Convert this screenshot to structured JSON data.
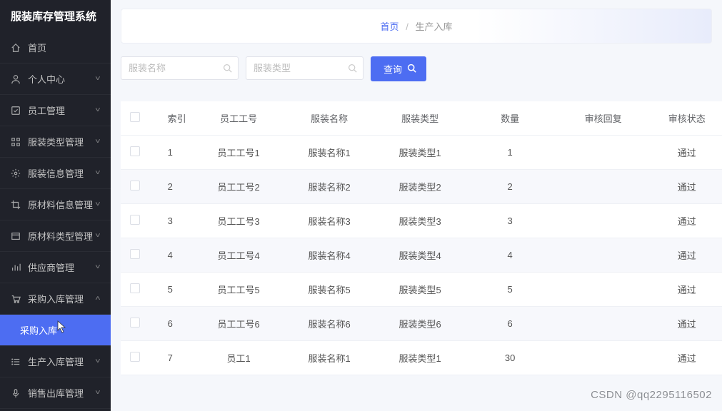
{
  "appTitle": "服装库存管理系统",
  "sidebar": {
    "items": [
      {
        "label": "首页",
        "icon": "home"
      },
      {
        "label": "个人中心",
        "icon": "user",
        "expandable": true,
        "state": "down"
      },
      {
        "label": "员工管理",
        "icon": "check-square",
        "expandable": true,
        "state": "down"
      },
      {
        "label": "服装类型管理",
        "icon": "grid",
        "expandable": true,
        "state": "down"
      },
      {
        "label": "服装信息管理",
        "icon": "gear",
        "expandable": true,
        "state": "down"
      },
      {
        "label": "原材料信息管理",
        "icon": "crop",
        "expandable": true,
        "state": "down"
      },
      {
        "label": "原材料类型管理",
        "icon": "window",
        "expandable": true,
        "state": "down"
      },
      {
        "label": "供应商管理",
        "icon": "bars",
        "expandable": true,
        "state": "down"
      },
      {
        "label": "采购入库管理",
        "icon": "cart",
        "expandable": true,
        "state": "up"
      },
      {
        "label": "采购入库",
        "sub": true,
        "active": true
      },
      {
        "label": "生产入库管理",
        "icon": "list",
        "expandable": true,
        "state": "down"
      },
      {
        "label": "销售出库管理",
        "icon": "mic",
        "expandable": true,
        "state": "down"
      }
    ]
  },
  "breadcrumb": {
    "home": "首页",
    "current": "生产入库"
  },
  "filters": {
    "name_placeholder": "服装名称",
    "type_placeholder": "服装类型",
    "query_label": "查询"
  },
  "table": {
    "headers": [
      "索引",
      "员工工号",
      "服装名称",
      "服装类型",
      "数量",
      "审核回复",
      "审核状态"
    ],
    "rows": [
      {
        "idx": "1",
        "emp": "员工工号1",
        "name": "服装名称1",
        "type": "服装类型1",
        "qty": "1",
        "reply": "",
        "status": "通过"
      },
      {
        "idx": "2",
        "emp": "员工工号2",
        "name": "服装名称2",
        "type": "服装类型2",
        "qty": "2",
        "reply": "",
        "status": "通过"
      },
      {
        "idx": "3",
        "emp": "员工工号3",
        "name": "服装名称3",
        "type": "服装类型3",
        "qty": "3",
        "reply": "",
        "status": "通过"
      },
      {
        "idx": "4",
        "emp": "员工工号4",
        "name": "服装名称4",
        "type": "服装类型4",
        "qty": "4",
        "reply": "",
        "status": "通过"
      },
      {
        "idx": "5",
        "emp": "员工工号5",
        "name": "服装名称5",
        "type": "服装类型5",
        "qty": "5",
        "reply": "",
        "status": "通过"
      },
      {
        "idx": "6",
        "emp": "员工工号6",
        "name": "服装名称6",
        "type": "服装类型6",
        "qty": "6",
        "reply": "",
        "status": "通过"
      },
      {
        "idx": "7",
        "emp": "员工1",
        "name": "服装名称1",
        "type": "服装类型1",
        "qty": "30",
        "reply": "",
        "status": "通过"
      }
    ]
  },
  "watermark": "CSDN @qq2295116502"
}
